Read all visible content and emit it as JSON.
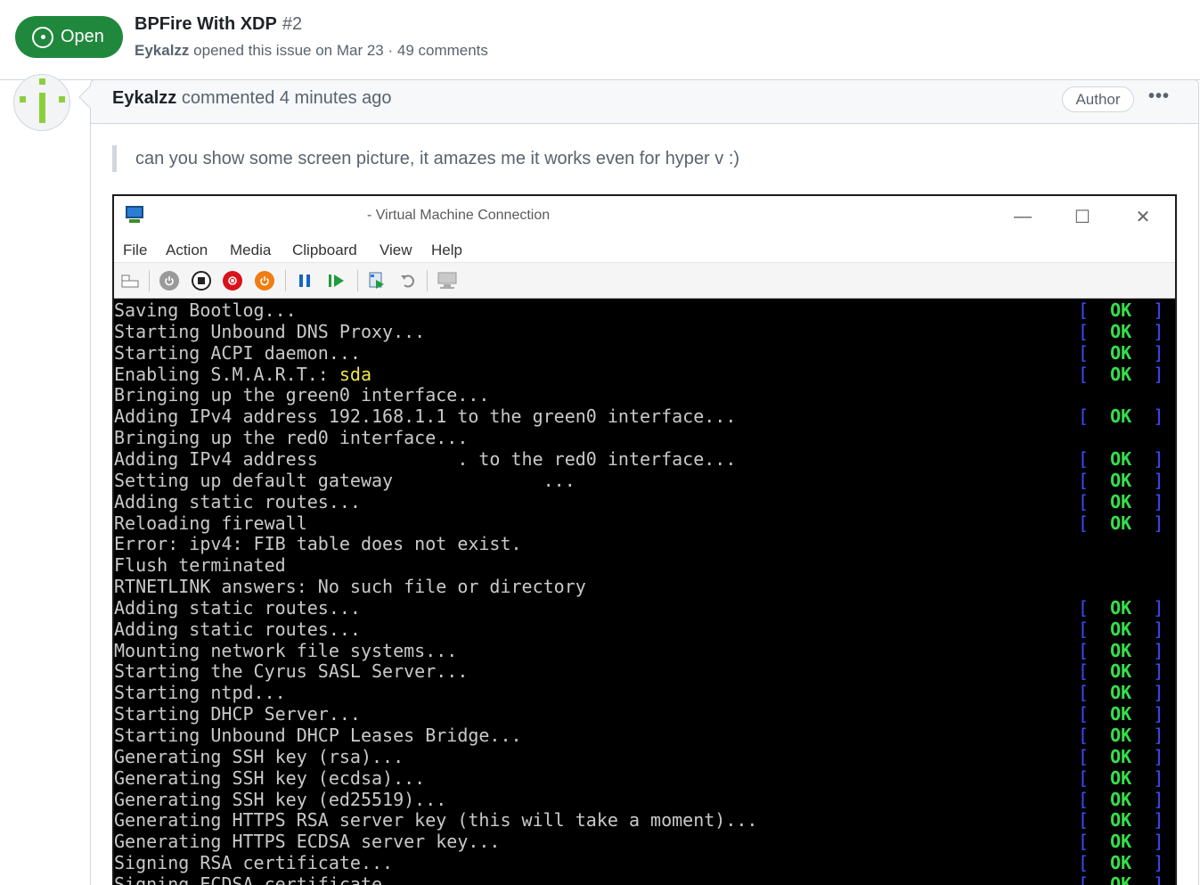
{
  "issue": {
    "state": "Open",
    "title": "BPFire With XDP",
    "number": "#2",
    "author": "Eykalzz",
    "meta_text": "opened this issue on Mar 23 · 49 comments"
  },
  "comment": {
    "author": "Eykalzz",
    "action": "commented 4 minutes ago",
    "badge": "Author",
    "more": "•••",
    "quote": "can you show some screen picture, it amazes me it works even for hyper v :)"
  },
  "vm": {
    "title": "- Virtual Machine Connection",
    "controls": {
      "minimize": "—",
      "maximize": "☐",
      "close": "✕"
    },
    "menu": [
      "File",
      "Action",
      "Media",
      "Clipboard",
      "View",
      "Help"
    ],
    "ok_label": "OK",
    "ok_open": "[",
    "ok_close": "]",
    "lines": [
      {
        "pre": "Saving Bootlog...",
        "hl": "",
        "ok": true
      },
      {
        "pre": "Starting Unbound DNS Proxy...",
        "hl": "",
        "ok": true
      },
      {
        "pre": "Starting ACPI daemon...",
        "hl": "",
        "ok": true
      },
      {
        "pre": "Enabling S.M.A.R.T.: ",
        "hl": "sda",
        "ok": true
      },
      {
        "pre": "Bringing up the green0 interface...",
        "hl": "",
        "ok": false
      },
      {
        "pre": "Adding IPv4 address 192.168.1.1 to the green0 interface...",
        "hl": "",
        "ok": true
      },
      {
        "pre": "Bringing up the red0 interface...",
        "hl": "",
        "ok": false
      },
      {
        "pre": "Adding IPv4 address             . to the red0 interface...",
        "hl": "",
        "ok": true
      },
      {
        "pre": "Setting up default gateway              ...",
        "hl": "",
        "ok": true
      },
      {
        "pre": "Adding static routes...",
        "hl": "",
        "ok": true
      },
      {
        "pre": "Reloading firewall",
        "hl": "",
        "ok": true
      },
      {
        "pre": "Error: ipv4: FIB table does not exist.",
        "hl": "",
        "ok": false
      },
      {
        "pre": "Flush terminated",
        "hl": "",
        "ok": false
      },
      {
        "pre": "RTNETLINK answers: No such file or directory",
        "hl": "",
        "ok": false
      },
      {
        "pre": "Adding static routes...",
        "hl": "",
        "ok": true
      },
      {
        "pre": "Adding static routes...",
        "hl": "",
        "ok": true
      },
      {
        "pre": "Mounting network file systems...",
        "hl": "",
        "ok": true
      },
      {
        "pre": "Starting the Cyrus SASL Server...",
        "hl": "",
        "ok": true
      },
      {
        "pre": "Starting ntpd...",
        "hl": "",
        "ok": true
      },
      {
        "pre": "Starting DHCP Server...",
        "hl": "",
        "ok": true
      },
      {
        "pre": "Starting Unbound DHCP Leases Bridge...",
        "hl": "",
        "ok": true
      },
      {
        "pre": "Generating SSH key (rsa)...",
        "hl": "",
        "ok": true
      },
      {
        "pre": "Generating SSH key (ecdsa)...",
        "hl": "",
        "ok": true
      },
      {
        "pre": "Generating SSH key (ed25519)...",
        "hl": "",
        "ok": true
      },
      {
        "pre": "Generating HTTPS RSA server key (this will take a moment)...",
        "hl": "",
        "ok": true
      },
      {
        "pre": "Generating HTTPS ECDSA server key...",
        "hl": "",
        "ok": true
      },
      {
        "pre": "Signing RSA certificate...",
        "hl": "",
        "ok": true
      },
      {
        "pre": "Signing ECDSA certificate...",
        "hl": "",
        "ok": true
      }
    ]
  }
}
